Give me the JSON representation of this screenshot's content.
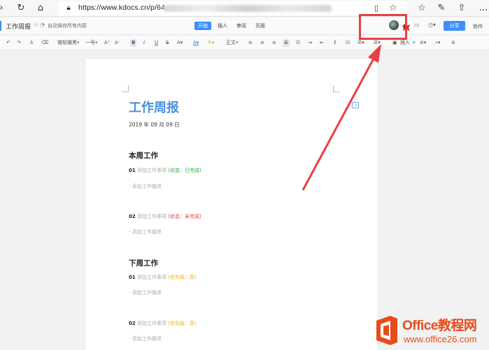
{
  "browser": {
    "url": "https://www.kdocs.cn/p/64",
    "icons": [
      "left-arrow-icon",
      "refresh-icon",
      "home-icon",
      "lock-icon",
      "reader-icon",
      "star-icon",
      "favorites-icon",
      "pen-icon",
      "share-icon"
    ]
  },
  "header": {
    "doc_title": "工作周报",
    "autosave": "自动保存所有内容",
    "tabs": [
      "开始",
      "插入",
      "审阅",
      "页面"
    ],
    "active_tab": 0,
    "share_label": "分享",
    "collab_label": "协作"
  },
  "toolbar": {
    "font_name": "微软雅黑",
    "font_size": "一号",
    "style_name": "正文",
    "insert_label": "插入",
    "bold_symbol": "B",
    "italic_symbol": "I",
    "underline_symbol": "U",
    "strike_symbol": "S"
  },
  "document": {
    "heading": "工作周报",
    "date": "2019 年 09 月 09 日",
    "this_week": {
      "title": "本周工作",
      "items": [
        {
          "num": "01",
          "placeholder": "添加工作事项",
          "status": "(状态：已完成)",
          "status_color": "#2eaa3c",
          "desc": "- 添加工作描述"
        },
        {
          "num": "02",
          "placeholder": "添加工作事项",
          "status": "(状态：未完成)",
          "status_color": "#e04040",
          "desc": "- 添加工作描述"
        }
      ]
    },
    "next_week": {
      "title": "下周工作",
      "items": [
        {
          "num": "01",
          "placeholder": "添加工作事项",
          "status": "(优先级：高)",
          "status_color": "#f0b400",
          "desc": "- 添加工作描述"
        },
        {
          "num": "02",
          "placeholder": "添加工作事项",
          "status": "(优先级：高)",
          "status_color": "#f0b400",
          "desc": "- 添加工作描述"
        }
      ]
    }
  },
  "watermark": {
    "brand": "Office教程网",
    "site": "www.office26.com"
  },
  "colors": {
    "accent": "#3e8ef7",
    "heading": "#4a8fe0",
    "annotation": "#e84043"
  }
}
